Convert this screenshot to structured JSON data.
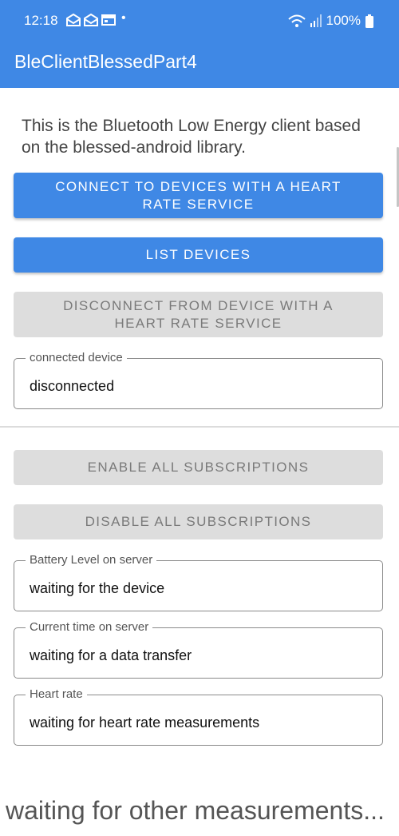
{
  "status_bar": {
    "time": "12:18",
    "battery": "100%",
    "notification_icons": [
      "mail-icon",
      "mail-icon",
      "window-icon"
    ],
    "dot": "•"
  },
  "app_bar": {
    "title": "BleClientBlessedPart4"
  },
  "intro_text": "This is the Bluetooth Low Energy client based on the blessed-android library.",
  "buttons": {
    "connect": "CONNECT TO DEVICES WITH A HEART RATE SERVICE",
    "list": "LIST DEVICES",
    "disconnect": "DISCONNECT FROM DEVICE WITH A HEART RATE SERVICE",
    "enable_subs": "ENABLE ALL SUBSCRIPTIONS",
    "disable_subs": "DISABLE ALL SUBSCRIPTIONS"
  },
  "fields": {
    "connected_device": {
      "label": "connected device",
      "value": "disconnected"
    },
    "battery_level": {
      "label": "Battery Level on server",
      "value": "waiting for the device"
    },
    "current_time": {
      "label": "Current time on server",
      "value": "waiting for a data transfer"
    },
    "heart_rate": {
      "label": "Heart rate",
      "value": "waiting for heart rate measurements"
    }
  },
  "footer_text": "waiting for other measurements...",
  "colors": {
    "primary": "#3f88e5",
    "disabled_bg": "#dddddd",
    "disabled_text": "#7a7a7a"
  }
}
